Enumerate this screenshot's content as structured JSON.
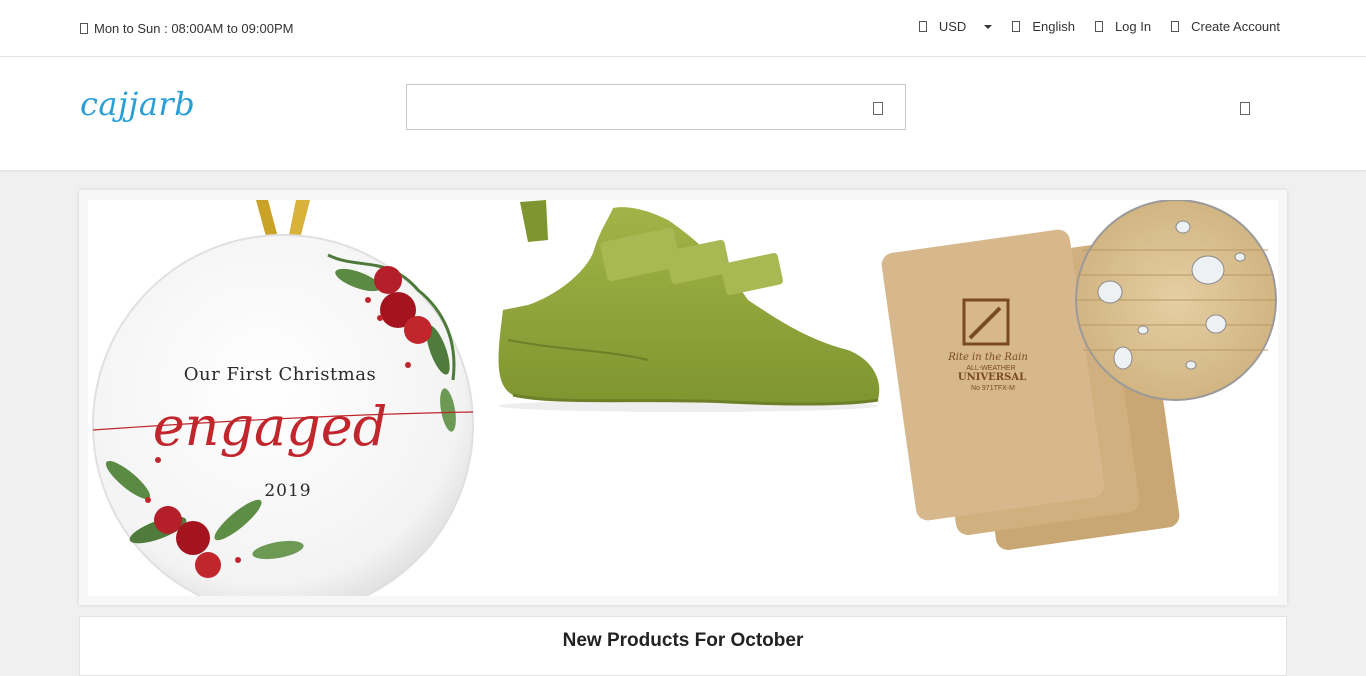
{
  "topbar": {
    "hours": "Mon to Sun : 08:00AM to 09:00PM",
    "currency": "USD",
    "language": "English",
    "login": "Log In",
    "create_account": "Create Account"
  },
  "header": {
    "logo": "cajjarb",
    "search_placeholder": ""
  },
  "banner": {
    "ornament_line1": "Our First Christmas",
    "ornament_script": "engaged",
    "ornament_year": "2019",
    "notebook_brand": "Rite in the Rain",
    "notebook_line1": "ALL-WEATHER",
    "notebook_line2": "UNIVERSAL",
    "notebook_code": "No 971TFX-M"
  },
  "section": {
    "title": "New Products For October"
  },
  "colors": {
    "logo": "#2a9fd6",
    "shoe": "#8fa53a",
    "ornament_red": "#c0262c",
    "notebook": "#d7b88d"
  }
}
